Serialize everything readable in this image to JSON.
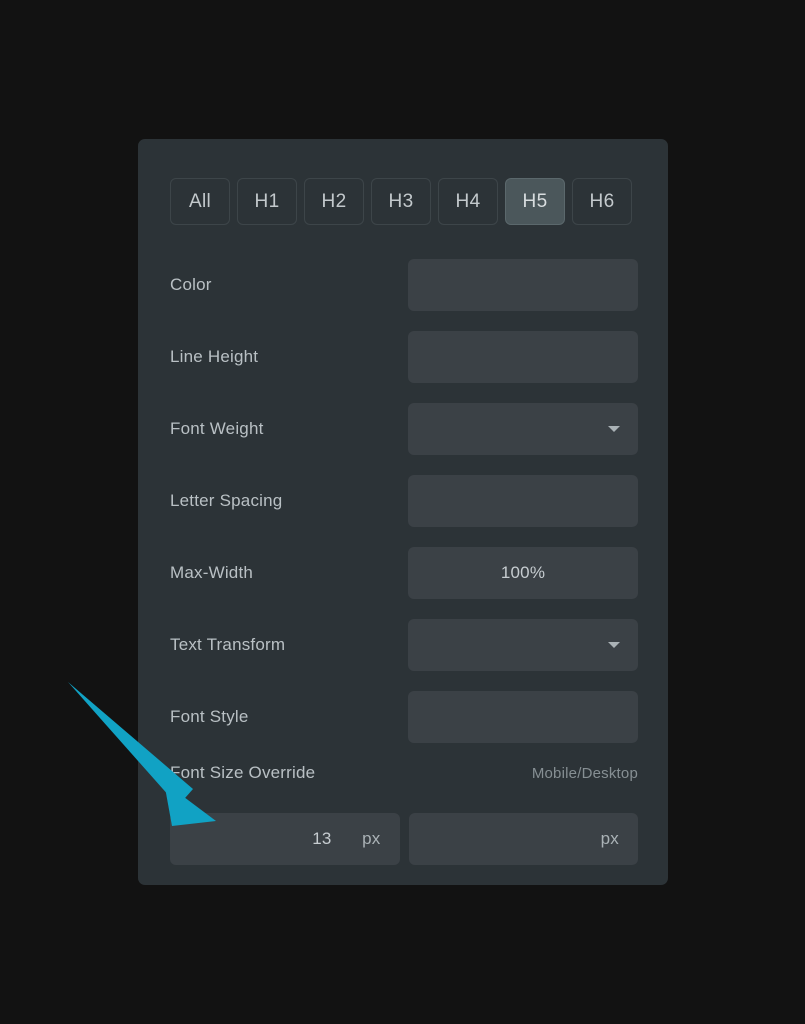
{
  "colors": {
    "page_background": "#121212",
    "panel_background": "#2c3337",
    "field_background": "#3b4146",
    "tab_active_background": "#4b575b",
    "label_text": "#b9c0c4",
    "muted_text": "#868f93",
    "annotation_arrow": "#11a2c4"
  },
  "panel": {
    "tabs": [
      {
        "label": "All",
        "active": false
      },
      {
        "label": "H1",
        "active": false
      },
      {
        "label": "H2",
        "active": false
      },
      {
        "label": "H3",
        "active": false
      },
      {
        "label": "H4",
        "active": false
      },
      {
        "label": "H5",
        "active": true
      },
      {
        "label": "H6",
        "active": false
      }
    ],
    "properties": [
      {
        "label": "Color",
        "value": "",
        "type": "text"
      },
      {
        "label": "Line Height",
        "value": "",
        "type": "text"
      },
      {
        "label": "Font Weight",
        "value": "",
        "type": "select"
      },
      {
        "label": "Letter Spacing",
        "value": "",
        "type": "text"
      },
      {
        "label": "Max-Width",
        "value": "100%",
        "type": "text"
      },
      {
        "label": "Text Transform",
        "value": "",
        "type": "select"
      },
      {
        "label": "Font Style",
        "value": "",
        "type": "text"
      }
    ],
    "font_size_override": {
      "label": "Font Size Override",
      "scope_label": "Mobile/Desktop",
      "mobile": {
        "value": "13",
        "unit": "px"
      },
      "desktop": {
        "value": "",
        "unit": "px"
      }
    }
  },
  "annotation": {
    "arrow_icon": "arrow-pointer-icon",
    "points_to": "font-size-override-mobile-input"
  }
}
